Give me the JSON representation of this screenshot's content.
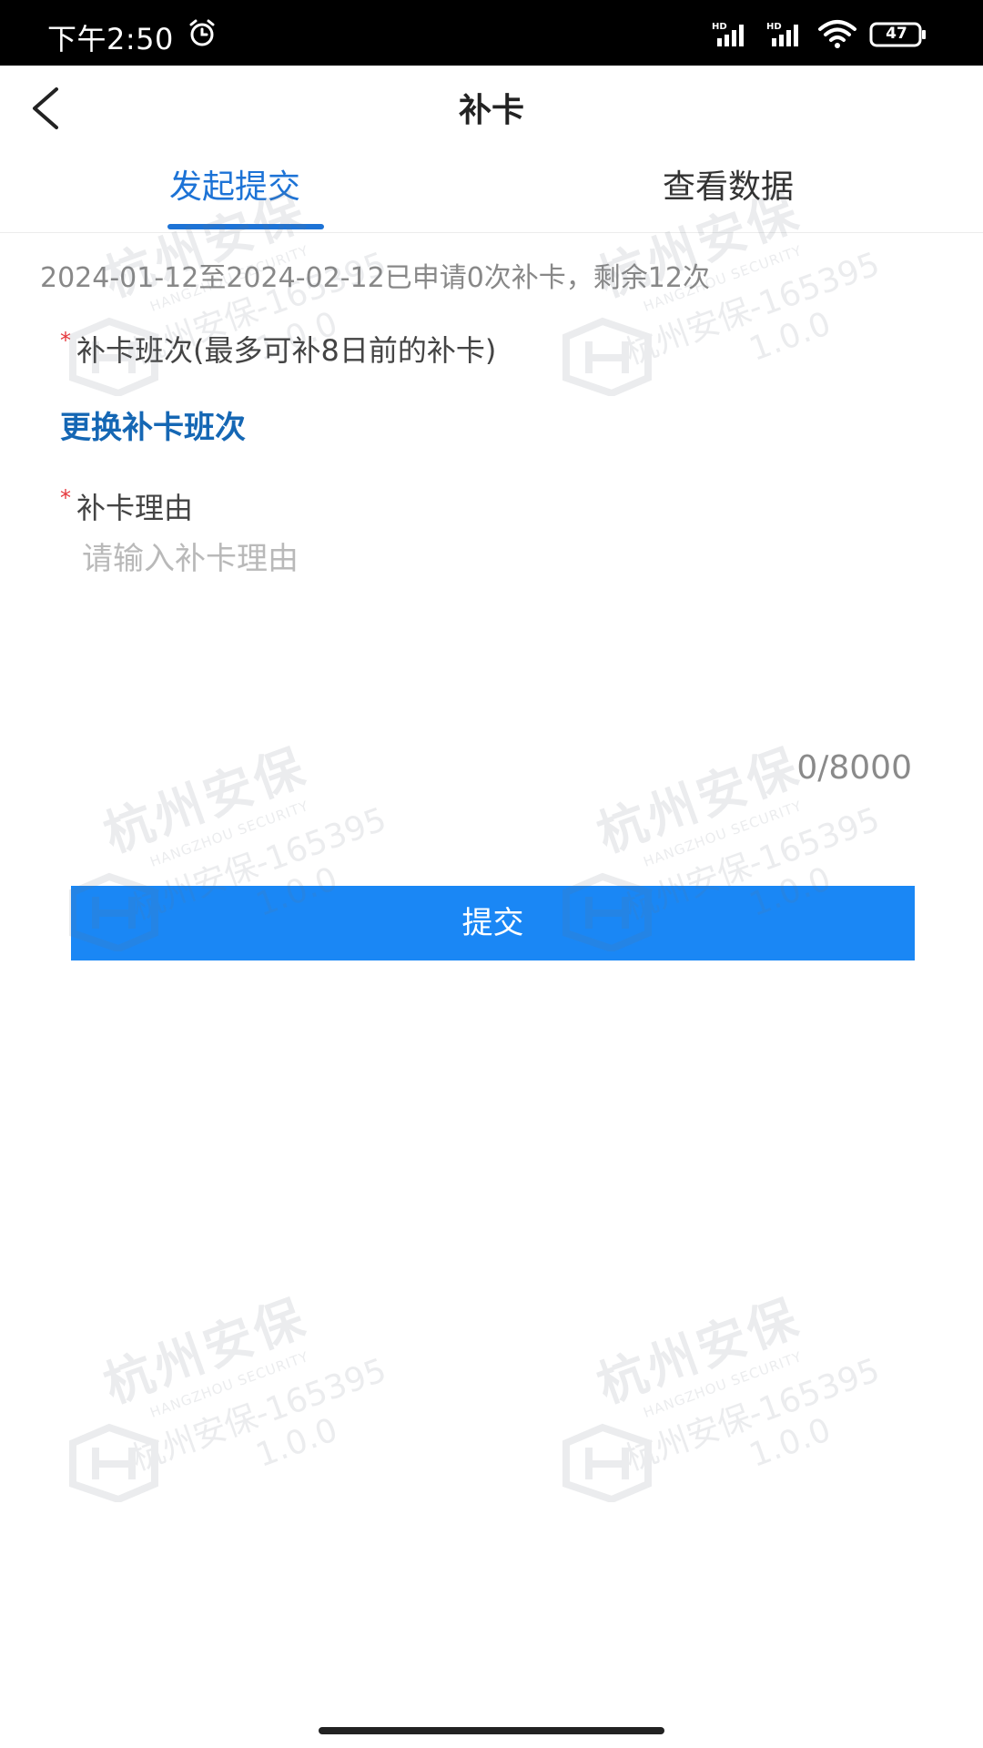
{
  "status_bar": {
    "time": "下午2:50",
    "battery": "47",
    "icons": [
      "alarm-icon",
      "signal-icon",
      "signal-icon",
      "wifi-icon",
      "battery-icon"
    ]
  },
  "nav": {
    "title": "补卡",
    "back_icon": "chevron-left-icon"
  },
  "tabs": [
    {
      "label": "发起提交",
      "active": true
    },
    {
      "label": "查看数据",
      "active": false
    }
  ],
  "info_text": "2024-01-12至2024-02-12已申请0次补卡，剩余12次",
  "form": {
    "required_mark": "*",
    "shift_label": "补卡班次(最多可补8日前的补卡)",
    "change_shift_link": "更换补卡班次",
    "reason_label": "补卡理由",
    "reason_value": "",
    "reason_placeholder": "请输入补卡理由",
    "char_count": "0/8000",
    "submit_label": "提交"
  },
  "watermark": {
    "brand": "杭州安保",
    "brand_en": "HANGZHOU SECURITY",
    "user": "杭州安保-165395",
    "version": "1.0.0"
  },
  "colors": {
    "accent": "#1d73d6",
    "link": "#1567b4",
    "button": "#1a87f5",
    "required": "#e5373c",
    "muted": "#888888",
    "placeholder": "#b9b9b9"
  }
}
